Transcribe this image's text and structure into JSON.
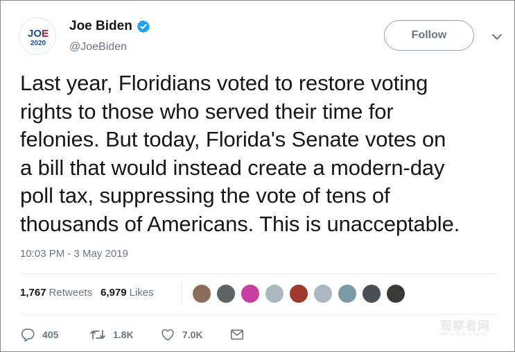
{
  "user": {
    "name": "Joe Biden",
    "handle": "@JoeBiden",
    "verified": true,
    "avatar": {
      "line1": "JOE",
      "line2": "2020",
      "brand_color": "#1b4a8f",
      "accent_color": "#e0263a"
    }
  },
  "header": {
    "follow_label": "Follow"
  },
  "tweet": {
    "lines": [
      "Last year, Floridians voted to restore voting",
      "rights to those who served their time for",
      "felonies. But today, Florida's Senate votes on",
      "a bill that would instead create a modern-day",
      "poll tax, suppressing the vote of tens of",
      "thousands of Americans. This is unacceptable."
    ],
    "timestamp": "10:03 PM - 3 May 2019"
  },
  "stats": {
    "retweets_count": "1,767",
    "retweets_label": "Retweets",
    "likes_count": "6,979",
    "likes_label": "Likes"
  },
  "liker_avatars": [
    {
      "color": "#8a6e5a"
    },
    {
      "color": "#5c6466"
    },
    {
      "color": "#c93fa0"
    },
    {
      "color": "#aab8c2"
    },
    {
      "color": "#a03a2c"
    },
    {
      "color": "#aab8c2"
    },
    {
      "color": "#7a9aaa"
    },
    {
      "color": "#4a4f55"
    },
    {
      "color": "#3a3a38"
    }
  ],
  "actions": {
    "reply_count": "405",
    "retweet_count": "1.8K",
    "like_count": "7.0K"
  },
  "watermark": {
    "text": "观察者网",
    "sub": "www.guancha.cn"
  },
  "colors": {
    "text": "#14171a",
    "muted": "#657786",
    "verified": "#1da1f2"
  }
}
